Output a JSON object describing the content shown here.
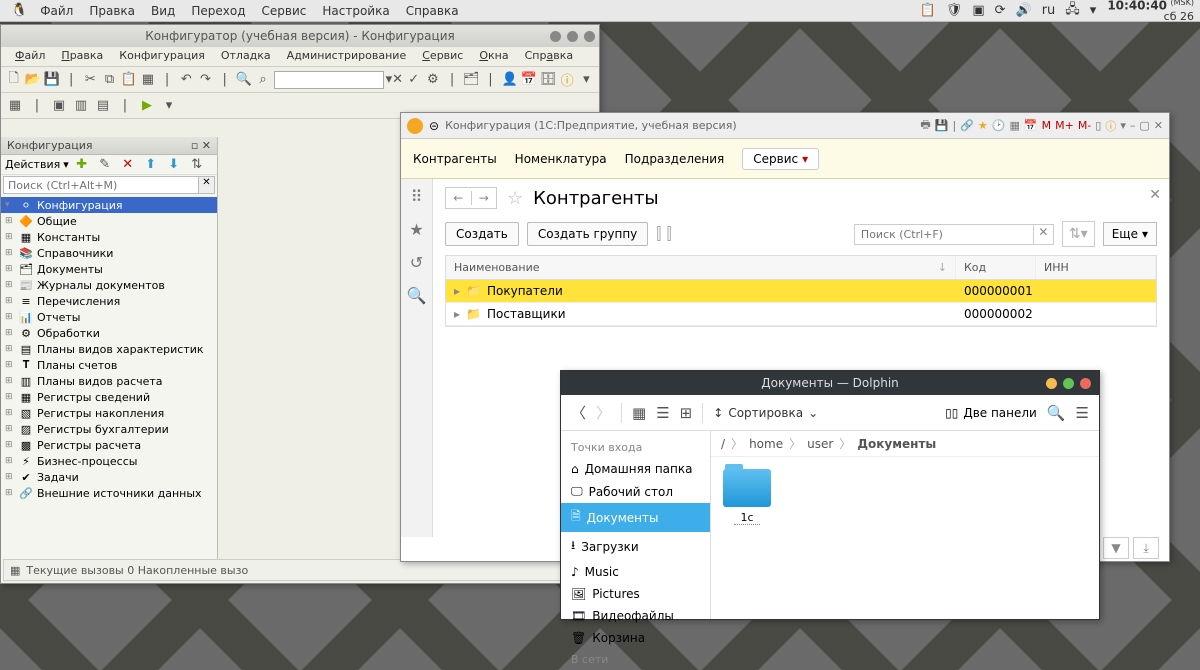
{
  "taskbar": {
    "menus": [
      "Файл",
      "Правка",
      "Вид",
      "Переход",
      "Сервис",
      "Настройка",
      "Справка"
    ],
    "lang": "ru",
    "clock_time": "10:40:40",
    "clock_tz": "(MSK)",
    "clock_date": "сб 26"
  },
  "configurator": {
    "title": "Конфигуратор (учебная версия) - Конфигурация",
    "menus": [
      "Файл",
      "Правка",
      "Конфигурация",
      "Отладка",
      "Администрирование",
      "Сервис",
      "Окна",
      "Справка"
    ],
    "panel_title": "Конфигурация",
    "actions_label": "Действия",
    "search_placeholder": "Поиск (Ctrl+Alt+M)",
    "tree": {
      "root": "Конфигурация",
      "items": [
        "Общие",
        "Константы",
        "Справочники",
        "Документы",
        "Журналы документов",
        "Перечисления",
        "Отчеты",
        "Обработки",
        "Планы видов характеристик",
        "Планы счетов",
        "Планы видов расчета",
        "Регистры сведений",
        "Регистры накопления",
        "Регистры бухгалтерии",
        "Регистры расчета",
        "Бизнес-процессы",
        "Задачи",
        "Внешние источники данных"
      ]
    },
    "status": "Текущие вызовы 0  Накопленные вызо"
  },
  "enterprise": {
    "title": "Конфигурация (1С:Предприятие, учебная версия)",
    "m_buttons": [
      "M",
      "M+",
      "M-"
    ],
    "nav": [
      "Контрагенты",
      "Номенклатура",
      "Подразделения"
    ],
    "service": "Сервис",
    "heading": "Контрагенты",
    "create": "Создать",
    "create_group": "Создать группу",
    "search_placeholder": "Поиск (Ctrl+F)",
    "more": "Еще",
    "columns": {
      "name": "Наименование",
      "code": "Код",
      "inn": "ИНН"
    },
    "rows": [
      {
        "name": "Покупатели",
        "code": "000000001",
        "inn": ""
      },
      {
        "name": "Поставщики",
        "code": "000000002",
        "inn": ""
      }
    ]
  },
  "dolphin": {
    "title": "Документы — Dolphin",
    "sort": "Сортировка",
    "panels": "Две панели",
    "side_header": "Точки входа",
    "side_items": [
      "Домашняя папка",
      "Рабочий стол",
      "Документы",
      "Загрузки",
      "Music",
      "Pictures",
      "Видеофайлы",
      "Корзина"
    ],
    "side_net": "В сети",
    "crumbs": [
      "home",
      "user",
      "Документы"
    ],
    "file": "1c"
  }
}
